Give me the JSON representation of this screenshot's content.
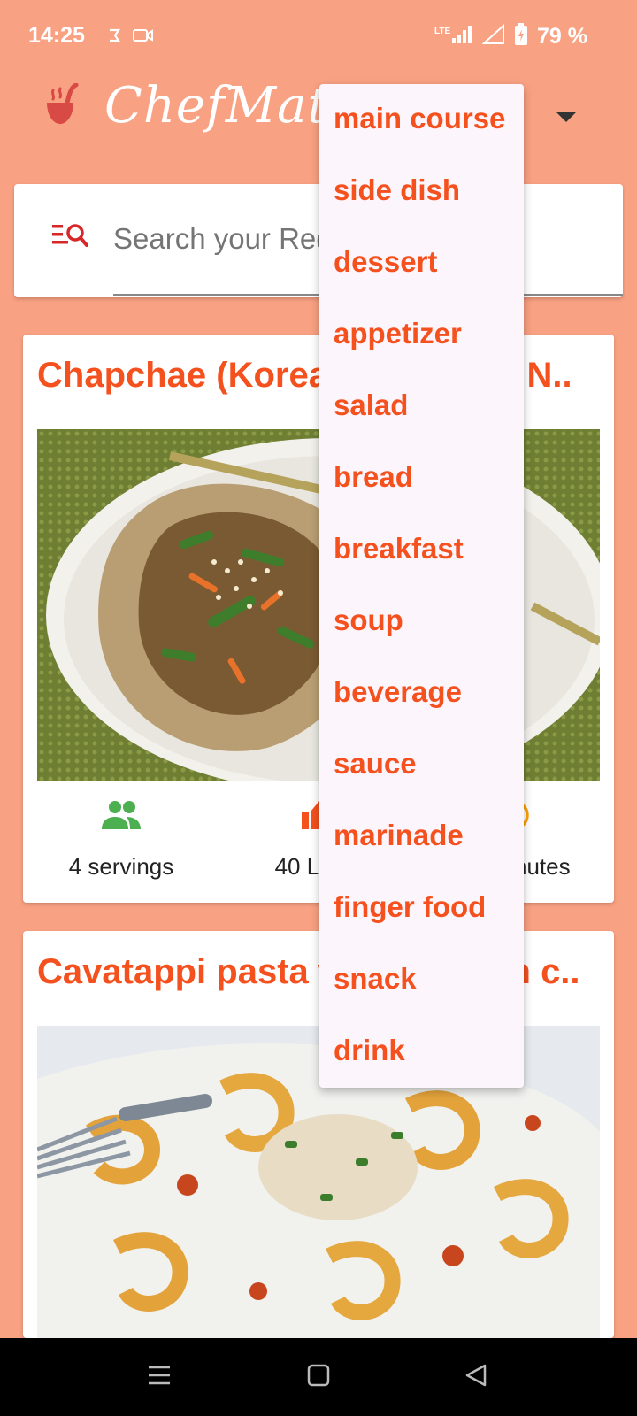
{
  "status_bar": {
    "time": "14:25",
    "battery": "79 %",
    "icons": [
      "sync-icon",
      "video-icon",
      "lte-signal-icon",
      "wifi-icon",
      "battery-charging-icon"
    ]
  },
  "app_bar": {
    "title": "ChefMate",
    "logo_icon": "ladle-icon",
    "dropdown_icon": "arrow-drop-down-icon"
  },
  "search": {
    "placeholder": "Search your Recipes",
    "icon": "manage-search-icon"
  },
  "recipes": [
    {
      "title": "Chapchae (Korean Stir-Fried N..",
      "servings": "4 servings",
      "likes": "40 Likes",
      "time": "45 minutes"
    },
    {
      "title": "Cavatappi pasta with chicken c..",
      "servings": "",
      "likes": "",
      "time": ""
    }
  ],
  "category_menu": {
    "items": [
      "main course",
      "side dish",
      "dessert",
      "appetizer",
      "salad",
      "bread",
      "breakfast",
      "soup",
      "beverage",
      "sauce",
      "marinade",
      "finger food",
      "snack",
      "drink"
    ]
  },
  "colors": {
    "background": "#F9A183",
    "accent": "#F4511E",
    "menu_background": "#FDF5FC",
    "servings_icon": "#4CAF50",
    "likes_icon": "#F4511E",
    "time_icon": "#FFA000"
  }
}
